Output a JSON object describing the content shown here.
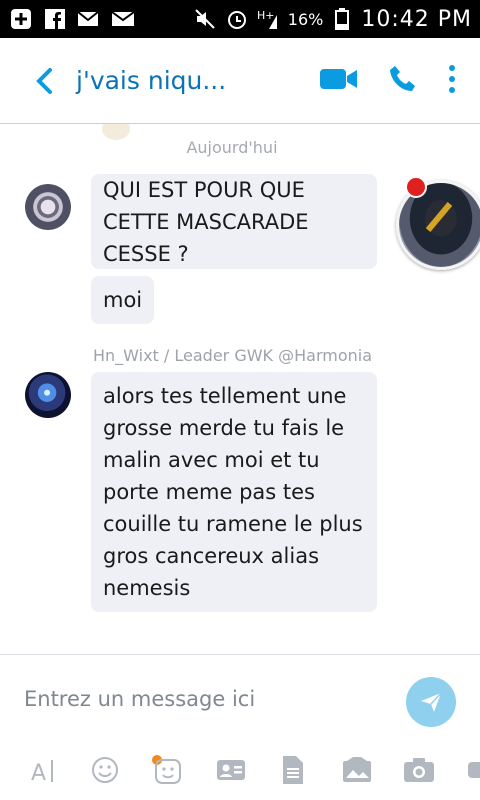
{
  "status_bar": {
    "battery_percent": "16%",
    "time": "10:42 PM"
  },
  "header": {
    "title": "j'vais niqu..."
  },
  "chat": {
    "date_separator": "Aujourd'hui",
    "messages": [
      {
        "text_lines": [
          "QUI EST POUR QUE",
          "CETTE MASCARADE",
          "CESSE ?"
        ]
      },
      {
        "text": "moi"
      },
      {
        "sender": "Hn_Wixt / Leader GWK @Harmonia",
        "text_lines": [
          "alors tes tellement une",
          "grosse merde tu fais le",
          "malin avec moi et tu",
          "porte meme pas tes",
          "couille tu ramene le plus",
          "gros cancereux alias",
          "nemesis"
        ]
      }
    ]
  },
  "composer": {
    "placeholder": "Entrez un message ici"
  },
  "colors": {
    "accent": "#0a73b8",
    "bubble": "#eef0f6",
    "send": "#8fd0ee"
  },
  "icons": [
    "back-arrow-icon",
    "video-call-icon",
    "phone-icon",
    "more-options-icon",
    "send-icon",
    "text-format-icon",
    "emoji-icon",
    "sticker-icon",
    "contact-card-icon",
    "file-icon",
    "media-icon",
    "camera-icon"
  ]
}
